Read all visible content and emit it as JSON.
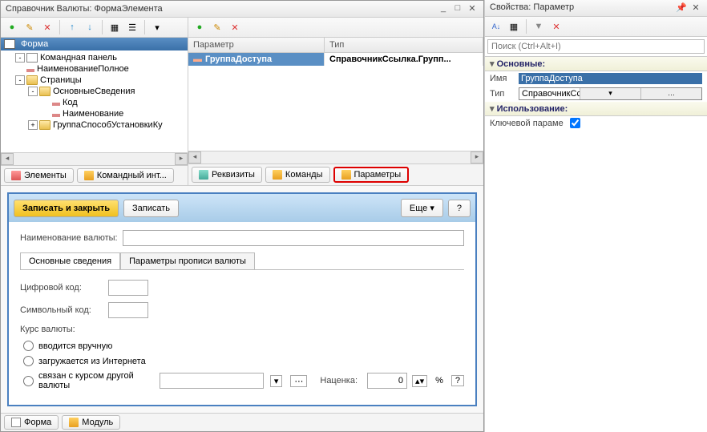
{
  "window": {
    "title": "Справочник Валюты: ФормаЭлемента"
  },
  "left_toolbar_icons": [
    "add",
    "edit",
    "delete",
    "up",
    "down",
    "table",
    "group",
    "more"
  ],
  "tree_header": "Форма",
  "tree": [
    {
      "level": 1,
      "exp": "-",
      "icon": "cmd",
      "label": "Командная панель"
    },
    {
      "level": 1,
      "exp": "",
      "icon": "label",
      "label": "НаименованиеПолное"
    },
    {
      "level": 1,
      "exp": "-",
      "icon": "folder",
      "label": "Страницы"
    },
    {
      "level": 2,
      "exp": "-",
      "icon": "folder",
      "label": "ОсновныеСведения"
    },
    {
      "level": 3,
      "exp": "",
      "icon": "field",
      "label": "Код"
    },
    {
      "level": 3,
      "exp": "",
      "icon": "field",
      "label": "Наименование"
    },
    {
      "level": 2,
      "exp": "+",
      "icon": "folder",
      "label": "ГруппаСпособУстановкиКу"
    }
  ],
  "left_tabs": [
    "Элементы",
    "Командный инт..."
  ],
  "right_toolbar_icons": [
    "add",
    "edit",
    "delete"
  ],
  "grid_headers": [
    "Параметр",
    "Тип"
  ],
  "grid_rows": [
    {
      "param": "ГруппаДоступа",
      "type": "СправочникСсылка.Групп..."
    }
  ],
  "right_tabs": [
    "Реквизиты",
    "Команды",
    "Параметры"
  ],
  "form_preview": {
    "save_close": "Записать и закрыть",
    "save": "Записать",
    "more": "Еще",
    "help": "?",
    "name_label": "Наименование валюты:",
    "tabs": [
      "Основные сведения",
      "Параметры прописи валюты"
    ],
    "code_dig": "Цифровой код:",
    "code_sym": "Символьный код:",
    "rate_label": "Курс валюты:",
    "radio1": "вводится вручную",
    "radio2": "загружается из Интернета",
    "radio3": "связан с курсом другой валюты",
    "markup": "Наценка:",
    "pct": "%"
  },
  "bottom_tabs": [
    "Форма",
    "Модуль"
  ],
  "prop": {
    "title": "Свойства: Параметр",
    "search_ph": "Поиск (Ctrl+Alt+I)",
    "sec1": "Основные:",
    "name_k": "Имя",
    "name_v": "ГруппаДоступа",
    "type_k": "Тип",
    "type_v": "СправочникСсылка.ГруппыПользоват",
    "sec2": "Использование:",
    "key_k": "Ключевой параме",
    "key_v": true
  }
}
